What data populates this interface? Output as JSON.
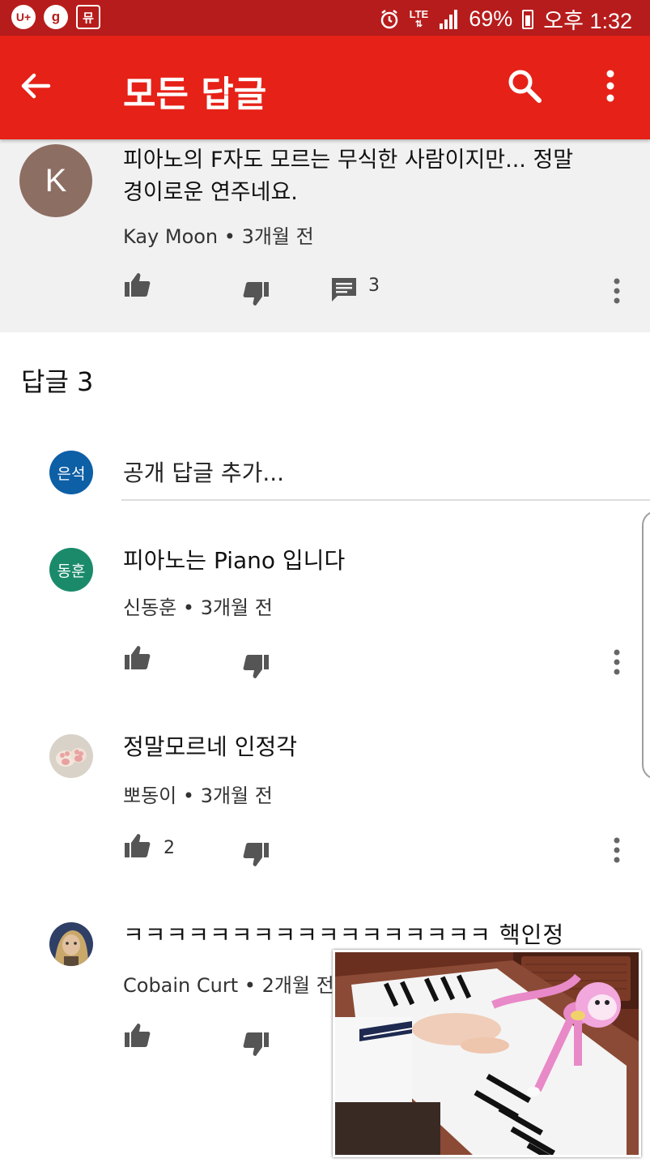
{
  "status_bar": {
    "left_icons": [
      "U+",
      "g",
      "뮤"
    ],
    "network": "LTE",
    "battery": "69%",
    "time": "오후 1:32"
  },
  "app_bar": {
    "title": "모든 답글",
    "back_icon": "arrow-back-icon",
    "search_icon": "search-icon",
    "more_icon": "more-vert-icon",
    "color": "#e62117"
  },
  "parent_comment": {
    "avatar_letter": "K",
    "text_line1": "피아노의 F자도 모르는 무식한 사람이지만... 정말",
    "text_line2": "경이로운 연주네요.",
    "author": "Kay Moon",
    "time": "3개월 전",
    "reply_count": "3"
  },
  "replies_header": "답글 3",
  "add_reply": {
    "avatar_text": "은석",
    "placeholder": "공개 답글 추가..."
  },
  "replies": [
    {
      "avatar_text": "동훈",
      "text": "피아노는 Piano 입니다",
      "author": "신동훈",
      "time": "3개월 전",
      "likes": ""
    },
    {
      "avatar_text": "",
      "text": "정말모르네 인정각",
      "author": "뽀동이",
      "time": "3개월 전",
      "likes": "2"
    },
    {
      "avatar_text": "",
      "text": "ㅋㅋㅋㅋㅋㅋㅋㅋㅋㅋㅋㅋㅋㅋㅋㅋㅋ 핵인정",
      "author": "Cobain Curt",
      "time": "2개월 전",
      "likes": ""
    }
  ],
  "mini_player": {
    "content": "piano-video-thumbnail"
  }
}
